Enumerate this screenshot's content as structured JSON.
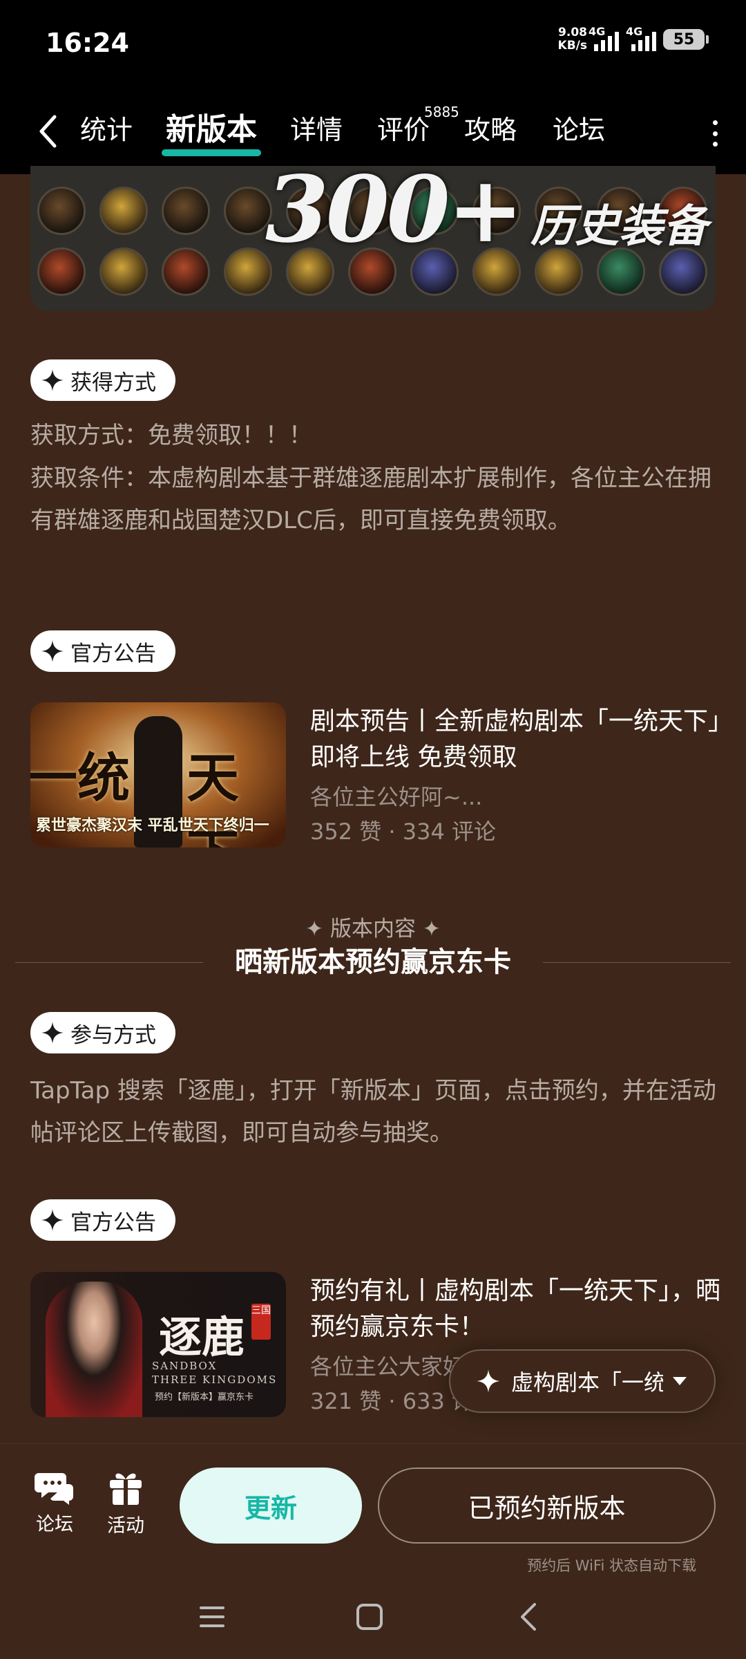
{
  "status_bar": {
    "time": "16:24",
    "net_speed_value": "9.08",
    "net_speed_unit": "KB/s",
    "signal_1": "4G",
    "signal_2": "4G",
    "battery": "55"
  },
  "tabs": [
    {
      "label": "统计"
    },
    {
      "label": "新版本",
      "active": true
    },
    {
      "label": "详情"
    },
    {
      "label": "评价",
      "badge": "5885"
    },
    {
      "label": "攻略"
    },
    {
      "label": "论坛"
    }
  ],
  "banner": {
    "number": "300+",
    "word": "历史装备"
  },
  "sections": {
    "obtain": {
      "pill": "获得方式",
      "method": "获取方式：免费领取！！！",
      "condition": "获取条件：本虚构剧本基于群雄逐鹿剧本扩展制作，各位主公在拥有群雄逐鹿和战国楚汉DLC后，即可直接免费领取。"
    },
    "announce1": {
      "pill": "官方公告",
      "title": "剧本预告丨全新虚构剧本「一统天下」即将上线 免费领取",
      "snippet": "各位主公好阿~...",
      "stats": "352 赞 · 334 评论",
      "thumb_big_left": "一统",
      "thumb_big_right": "天下",
      "thumb_small": "累世豪杰聚汉末 平乱世天下终归一"
    },
    "version": {
      "label": "版本内容",
      "title": "晒新版本预约赢京东卡"
    },
    "participate": {
      "pill": "参与方式",
      "text": "TapTap 搜索「逐鹿」，打开「新版本」页面，点击预约，并在活动帖评论区上传截图，即可自动参与抽奖。"
    },
    "announce2": {
      "pill": "官方公告",
      "title": "预约有礼丨虚构剧本「一统天下」，晒预约赢京东卡！",
      "snippet": "各位主公大家好",
      "stats": "321 赞 · 633 评",
      "thumb_title": "逐鹿",
      "thumb_seal": "三国",
      "thumb_en_1": "SANDBOX",
      "thumb_en_2": "THREE KINGDOMS",
      "thumb_sub": "预约【新版本】赢京东卡"
    }
  },
  "float_chip": {
    "text": "虚构剧本「一统"
  },
  "action_bar": {
    "forum": "论坛",
    "activity": "活动",
    "update": "更新",
    "reserved": "已预约新版本",
    "note": "预约后 WiFi 状态自动下载"
  },
  "colors": {
    "background": "#3e261a",
    "accent": "#16b7a6",
    "update_bg": "#e2f9f5"
  }
}
